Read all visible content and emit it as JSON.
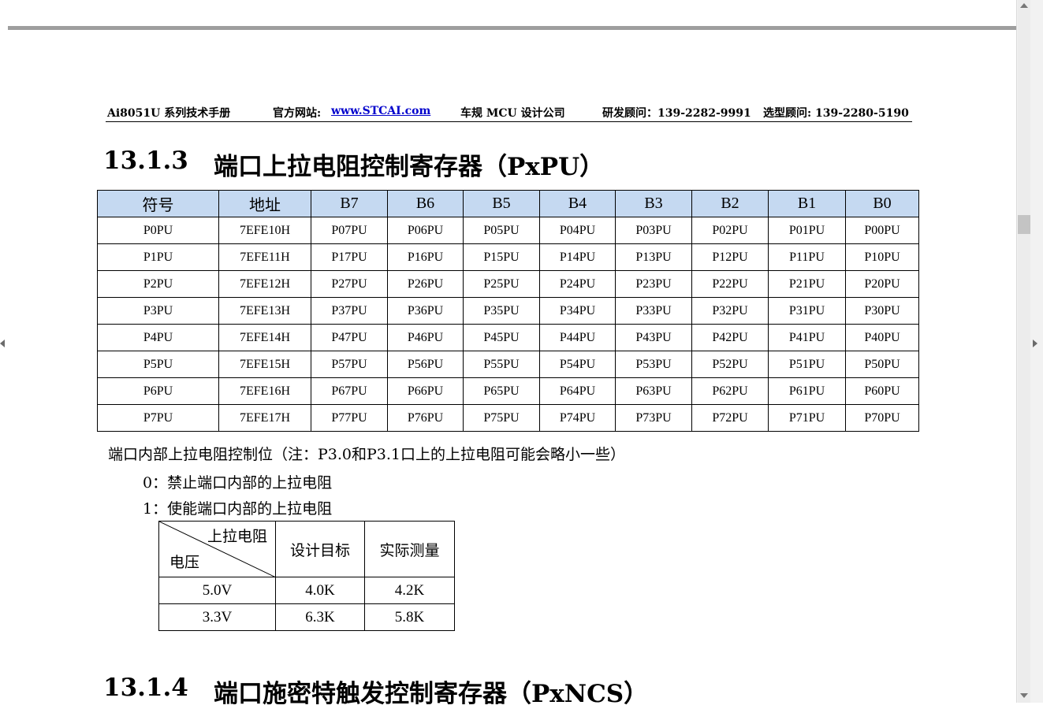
{
  "running_header": {
    "doc_title": "Ai8051U 系列技术手册",
    "website_label": "官方网站:",
    "website_url": "www.STCAI.com",
    "company": "车规 MCU 设计公司",
    "rd_contact": "研发顾问：139-2282-9991",
    "sales_contact": "选型顾问: 139-2280-5190"
  },
  "section_1": {
    "number": "13.1.3",
    "title": "端口上拉电阻控制寄存器（PxPU）"
  },
  "register_table": {
    "headers": [
      "符号",
      "地址",
      "B7",
      "B6",
      "B5",
      "B4",
      "B3",
      "B2",
      "B1",
      "B0"
    ],
    "rows": [
      [
        "P0PU",
        "7EFE10H",
        "P07PU",
        "P06PU",
        "P05PU",
        "P04PU",
        "P03PU",
        "P02PU",
        "P01PU",
        "P00PU"
      ],
      [
        "P1PU",
        "7EFE11H",
        "P17PU",
        "P16PU",
        "P15PU",
        "P14PU",
        "P13PU",
        "P12PU",
        "P11PU",
        "P10PU"
      ],
      [
        "P2PU",
        "7EFE12H",
        "P27PU",
        "P26PU",
        "P25PU",
        "P24PU",
        "P23PU",
        "P22PU",
        "P21PU",
        "P20PU"
      ],
      [
        "P3PU",
        "7EFE13H",
        "P37PU",
        "P36PU",
        "P35PU",
        "P34PU",
        "P33PU",
        "P32PU",
        "P31PU",
        "P30PU"
      ],
      [
        "P4PU",
        "7EFE14H",
        "P47PU",
        "P46PU",
        "P45PU",
        "P44PU",
        "P43PU",
        "P42PU",
        "P41PU",
        "P40PU"
      ],
      [
        "P5PU",
        "7EFE15H",
        "P57PU",
        "P56PU",
        "P55PU",
        "P54PU",
        "P53PU",
        "P52PU",
        "P51PU",
        "P50PU"
      ],
      [
        "P6PU",
        "7EFE16H",
        "P67PU",
        "P66PU",
        "P65PU",
        "P64PU",
        "P63PU",
        "P62PU",
        "P61PU",
        "P60PU"
      ],
      [
        "P7PU",
        "7EFE17H",
        "P77PU",
        "P76PU",
        "P75PU",
        "P74PU",
        "P73PU",
        "P72PU",
        "P71PU",
        "P70PU"
      ]
    ]
  },
  "description": {
    "intro": "端口内部上拉电阻控制位（注：P3.0和P3.1口上的上拉电阻可能会略小一些）",
    "option_0": "0：禁止端口内部的上拉电阻",
    "option_1": "1：使能端口内部的上拉电阻"
  },
  "resistor_table": {
    "corner_top": "上拉电阻",
    "corner_bottom": "电压",
    "col_design": "设计目标",
    "col_measured": "实际测量",
    "rows": [
      [
        "5.0V",
        "4.0K",
        "4.2K"
      ],
      [
        "3.3V",
        "6.3K",
        "5.8K"
      ]
    ]
  },
  "section_2": {
    "number": "13.1.4",
    "title": "端口施密特触发控制寄存器（PxNCS）"
  }
}
